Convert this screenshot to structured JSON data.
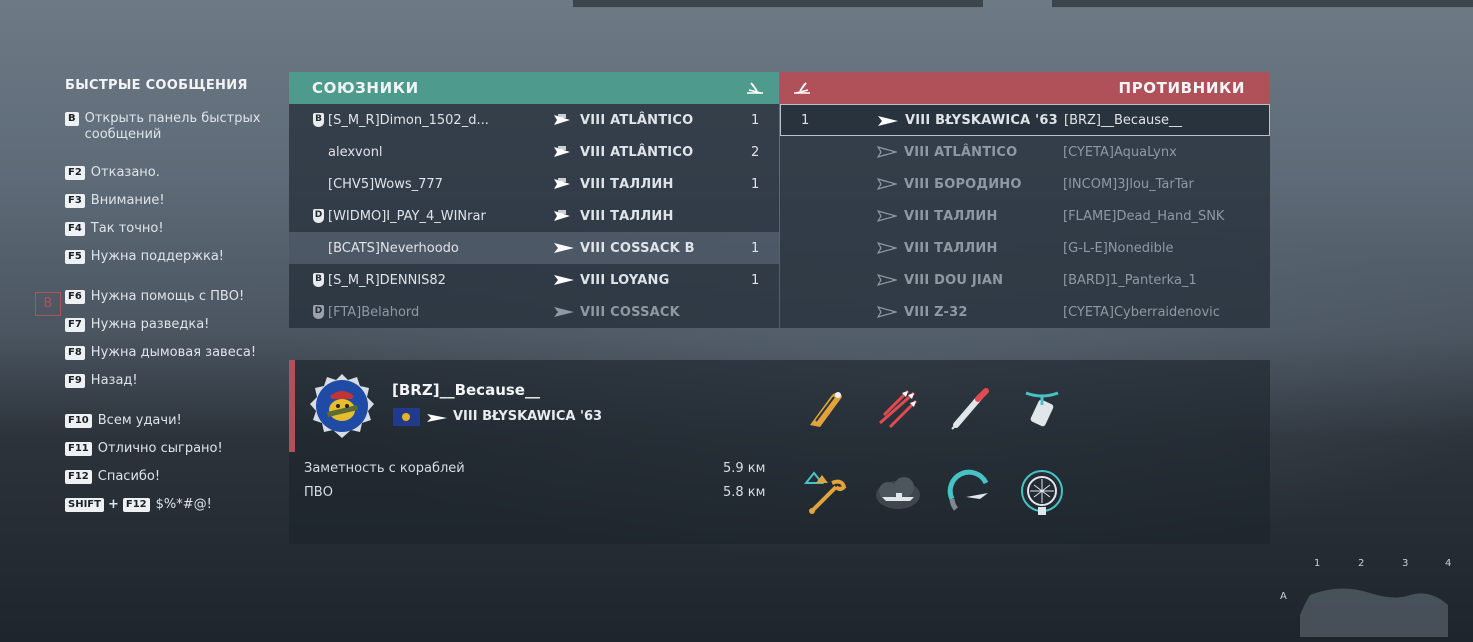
{
  "quick_messages": {
    "title": "БЫСТРЫЕ СООБЩЕНИЯ",
    "items": [
      {
        "key": "B",
        "text": "Открыть панель быстрых сообщений"
      },
      {
        "key": "F2",
        "text": "Отказано."
      },
      {
        "key": "F3",
        "text": "Внимание!"
      },
      {
        "key": "F4",
        "text": "Так точно!"
      },
      {
        "key": "F5",
        "text": "Нужна поддержка!"
      },
      {
        "key": "F6",
        "text": "Нужна помощь с ПВО!"
      },
      {
        "key": "F7",
        "text": "Нужна разведка!"
      },
      {
        "key": "F8",
        "text": "Нужна дымовая завеса!"
      },
      {
        "key": "F9",
        "text": "Назад!"
      },
      {
        "key": "F10",
        "text": "Всем удачи!"
      },
      {
        "key": "F11",
        "text": "Отлично сыграно!"
      },
      {
        "key": "F12",
        "text": "Спасибо!"
      },
      {
        "key": "SHIFT",
        "key2": "F12",
        "plus": "+",
        "text": "$%*#@!"
      }
    ]
  },
  "allies": {
    "title": "СОЮЗНИКИ",
    "rows": [
      {
        "division": "B",
        "name": "[S_M_R]Dimon_1502_d...",
        "ship": "VIII ATLÂNTICO",
        "kills": "1"
      },
      {
        "division": "",
        "name": "alexvonl",
        "ship": "VIII ATLÂNTICO",
        "kills": "2"
      },
      {
        "division": "",
        "name": "[CHV5]Wows_777",
        "ship": "VIII ТАЛЛИН",
        "kills": "1"
      },
      {
        "division": "D",
        "name": "[WIDMO]I_PAY_4_WINrar",
        "ship": "VIII ТАЛЛИН",
        "kills": ""
      },
      {
        "division": "",
        "name": "[BCATS]Neverhoodo",
        "ship": "VIII COSSACK B",
        "kills": "1"
      },
      {
        "division": "B",
        "name": "[S_M_R]DENNIS82",
        "ship": "VIII LOYANG",
        "kills": "1"
      },
      {
        "division": "D",
        "name": "[FTA]Belahord",
        "ship": "VIII COSSACK",
        "kills": ""
      }
    ]
  },
  "enemies": {
    "title": "ПРОТИВНИКИ",
    "rows": [
      {
        "kills": "1",
        "ship": "VIII BŁYSKAWICA '63",
        "name": "[BRZ]__Because__"
      },
      {
        "kills": "",
        "ship": "VIII ATLÂNTICO",
        "name": "[CYETA]AquaLynx"
      },
      {
        "kills": "",
        "ship": "VIII БОРОДИНО",
        "name": "[INCOM]3Jlou_TarTar"
      },
      {
        "kills": "",
        "ship": "VIII ТАЛЛИН",
        "name": "[FLAME]Dead_Hand_SNK"
      },
      {
        "kills": "",
        "ship": "VIII ТАЛЛИН",
        "name": "[G-L-E]Nonedible"
      },
      {
        "kills": "",
        "ship": "VIII DOU JIAN",
        "name": "[BARD]1_Panterka_1"
      },
      {
        "kills": "",
        "ship": "VIII Z-32",
        "name": "[CYETA]Cyberraidenovic"
      }
    ]
  },
  "player_card": {
    "name": "[BRZ]__Because__",
    "ship": "VIII BŁYSKAWICA '63",
    "stats": [
      {
        "label": "Заметность с кораблей",
        "value": "5.9 км"
      },
      {
        "label": "ПВО",
        "value": "5.8 км"
      }
    ],
    "modules": [
      "torpedo-reload-icon",
      "missile-squadron-icon",
      "torpedo-icon",
      "depth-charge-icon",
      "damage-control-icon",
      "smoke-generator-icon",
      "engine-boost-icon",
      "hydroacoustic-search-icon"
    ]
  },
  "minimap": {
    "columns": [
      "1",
      "2",
      "3",
      "4"
    ],
    "rows": [
      "A"
    ]
  },
  "world_marker": "B",
  "colors": {
    "ally": "#4e9a8c",
    "enemy": "#b05159"
  }
}
